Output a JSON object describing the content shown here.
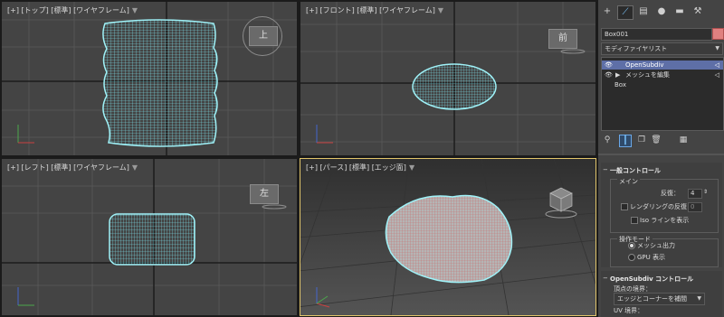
{
  "viewports": {
    "top": {
      "plus": "[+]",
      "view": "[トップ]",
      "shading_std": "[標準]",
      "shading": "[ワイヤフレーム]",
      "cube_label": "上"
    },
    "front": {
      "plus": "[+]",
      "view": "[フロント]",
      "shading_std": "[標準]",
      "shading": "[ワイヤフレーム]",
      "cube_label": "前"
    },
    "left": {
      "plus": "[+]",
      "view": "[レフト]",
      "shading_std": "[標準]",
      "shading": "[ワイヤフレーム]",
      "cube_label": "左"
    },
    "persp": {
      "plus": "[+]",
      "view": "[パース]",
      "shading_std": "[標準]",
      "shading": "[エッジ面]"
    }
  },
  "panel": {
    "object_name": "Box001",
    "modifier_list": "モディファイヤリスト",
    "stack": [
      {
        "label": "OpenSubdiv",
        "selected": true
      },
      {
        "label": "メッシュを編集",
        "selected": false
      },
      {
        "label": "Box",
        "selected": false
      }
    ],
    "general": {
      "title": "一般コントロール",
      "main_label": "メイン",
      "iterations_label": "反復：",
      "iterations_value": "4",
      "render_iter_label": "レンダリングの反復：",
      "render_iter_value": "0",
      "iso_label": "Iso ラインを表示",
      "op_mode_label": "操作モード",
      "mesh_output": "メッシュ出力",
      "gpu_display": "GPU 表示"
    },
    "opensubdiv": {
      "title": "OpenSubdiv コントロール",
      "vertex_boundary_label": "頂点の境界：",
      "vertex_boundary_value": "エッジとコーナーを補間",
      "uv_boundary_label": "UV 境界："
    }
  },
  "colors": {
    "viewport_bg": "#444444",
    "mesh_wire": "#7fe8f2",
    "active_border": "#e2c66b",
    "stack_selected": "#5e6fa7"
  }
}
